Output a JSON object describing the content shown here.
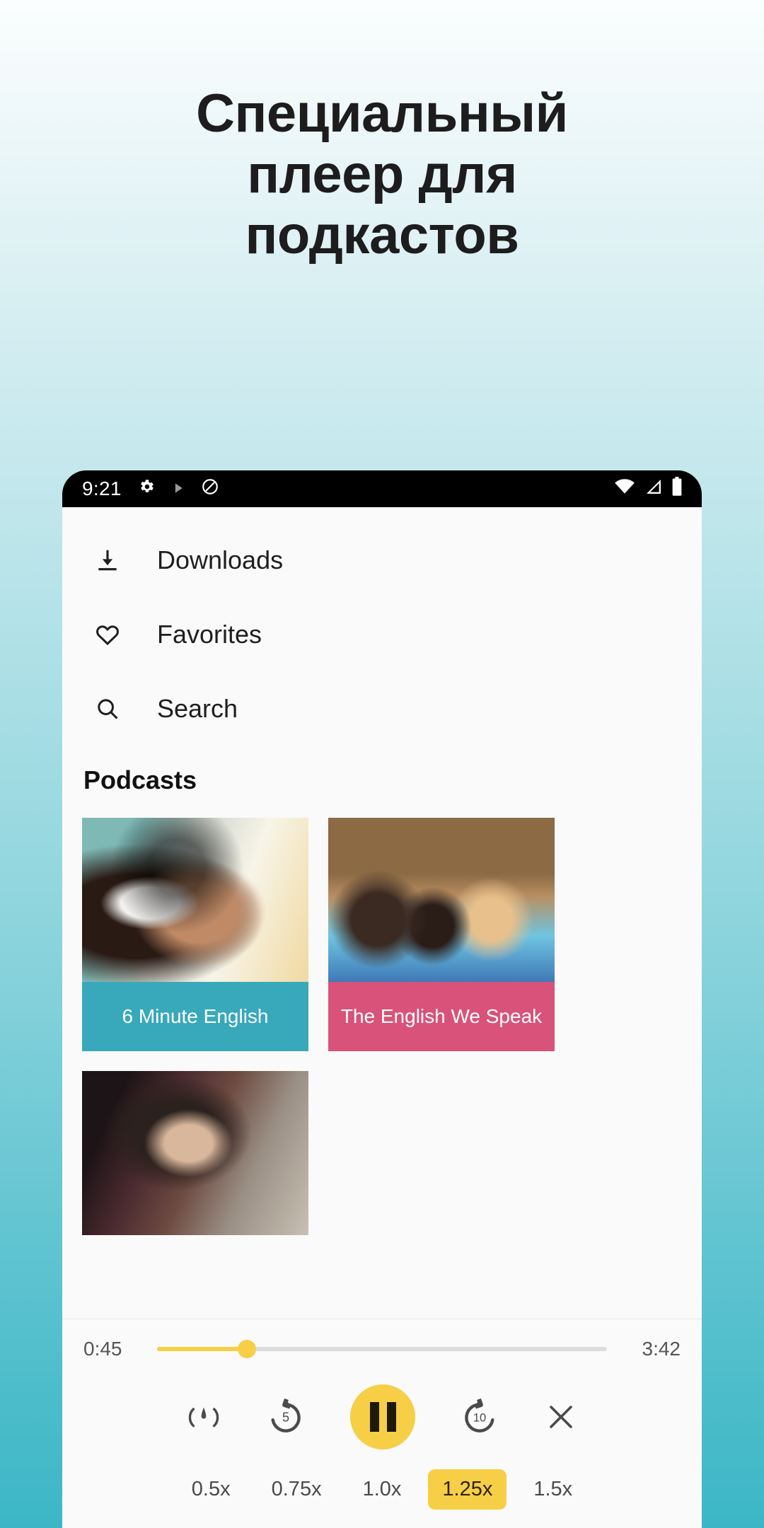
{
  "headline": {
    "line1": "Специальный",
    "line2": "плеер для",
    "line3": "подкастов"
  },
  "status_bar": {
    "time": "9:21",
    "icons": [
      "gear-icon",
      "play-triangle-icon",
      "do-not-disturb-icon",
      "wifi-icon",
      "cell-signal-icon",
      "battery-icon"
    ]
  },
  "nav": {
    "items": [
      {
        "label": "Downloads",
        "icon": "download-icon"
      },
      {
        "label": "Favorites",
        "icon": "heart-icon"
      },
      {
        "label": "Search",
        "icon": "search-icon"
      }
    ]
  },
  "section": {
    "title": "Podcasts"
  },
  "podcasts": [
    {
      "title": "6 Minute English",
      "color": "#38a9ba",
      "image": "woman-with-headphones"
    },
    {
      "title": "The English We Speak",
      "color": "#d9527a",
      "image": "students-in-library"
    },
    {
      "title": "",
      "color": "",
      "image": "woman-reading-red-book"
    }
  ],
  "player": {
    "current_time": "0:45",
    "total_time": "3:42",
    "progress_percent": 20,
    "accent_color": "#f7cf46",
    "controls": [
      {
        "name": "speed-gauge-icon"
      },
      {
        "name": "replay-5-icon",
        "label": "5"
      },
      {
        "name": "pause-icon"
      },
      {
        "name": "forward-10-icon",
        "label": "10"
      },
      {
        "name": "close-icon"
      }
    ],
    "speeds": [
      {
        "label": "0.5x",
        "selected": false
      },
      {
        "label": "0.75x",
        "selected": false
      },
      {
        "label": "1.0x",
        "selected": false
      },
      {
        "label": "1.25x",
        "selected": true
      },
      {
        "label": "1.5x",
        "selected": false
      }
    ]
  }
}
